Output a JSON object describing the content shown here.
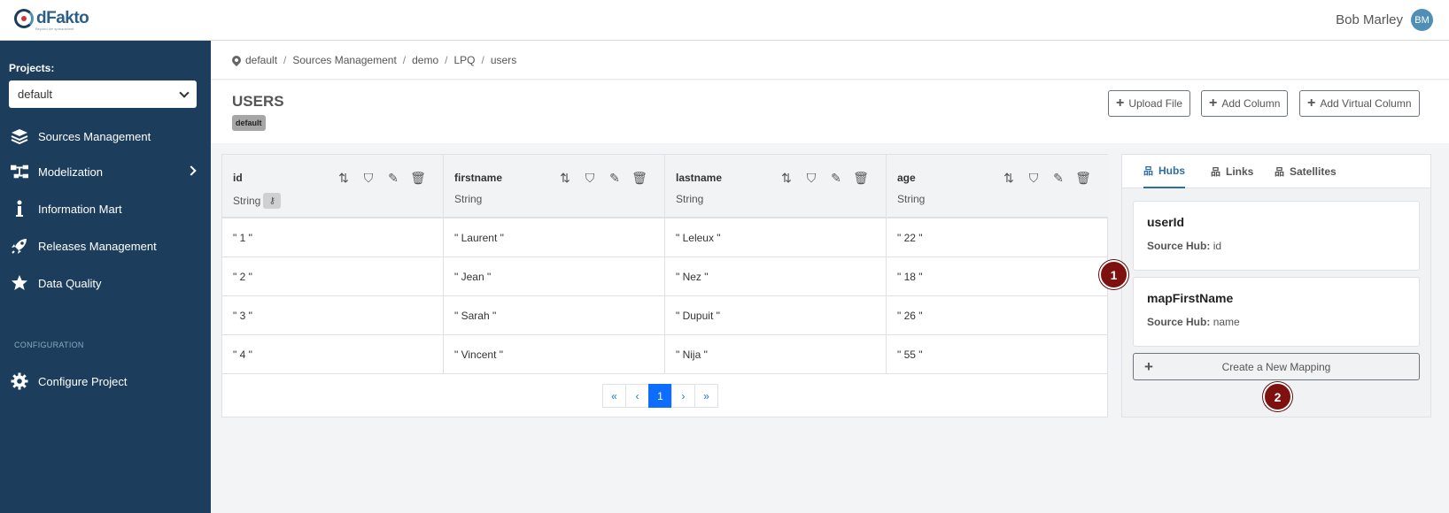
{
  "app": {
    "logo_text": "dFakto",
    "logo_tagline": "Beyond the spreadsheet"
  },
  "user": {
    "name": "Bob Marley",
    "initials": "BM"
  },
  "sidebar": {
    "projects_label": "Projects:",
    "project_selected": "default",
    "items": [
      {
        "label": "Sources Management",
        "icon": "layers-icon"
      },
      {
        "label": "Modelization",
        "icon": "sitemap-icon"
      },
      {
        "label": "Information Mart",
        "icon": "info-icon"
      },
      {
        "label": "Releases Management",
        "icon": "rocket-icon"
      },
      {
        "label": "Data Quality",
        "icon": "star-icon"
      }
    ],
    "config_label": "CONFIGURATION",
    "config_item": {
      "label": "Configure Project",
      "icon": "gear-icon"
    }
  },
  "breadcrumb": [
    "default",
    "Sources Management",
    "demo",
    "LPQ",
    "users"
  ],
  "page": {
    "title": "USERS",
    "badge": "default",
    "buttons": {
      "upload": "Upload File",
      "add_column": "Add Column",
      "add_virtual": "Add Virtual Column"
    }
  },
  "table": {
    "columns": [
      {
        "name": "id",
        "type": "String",
        "key": true
      },
      {
        "name": "firstname",
        "type": "String",
        "key": false
      },
      {
        "name": "lastname",
        "type": "String",
        "key": false
      },
      {
        "name": "age",
        "type": "String",
        "key": false
      }
    ],
    "rows": [
      [
        "\" 1 \"",
        "\" Laurent \"",
        "\" Leleux \"",
        "\" 22 \""
      ],
      [
        "\" 2 \"",
        "\" Jean \"",
        "\" Nez \"",
        "\" 18 \""
      ],
      [
        "\" 3 \"",
        "\" Sarah \"",
        "\" Dupuit \"",
        "\" 26 \""
      ],
      [
        "\" 4 \"",
        "\" Vincent \"",
        "\" Nija \"",
        "\" 55 \""
      ]
    ]
  },
  "pagination": {
    "first": "«",
    "prev": "‹",
    "current": "1",
    "next": "›",
    "last": "»"
  },
  "panel": {
    "tabs": [
      {
        "label": "Hubs",
        "active": true
      },
      {
        "label": "Links",
        "active": false
      },
      {
        "label": "Satellites",
        "active": false
      }
    ],
    "mappings": [
      {
        "title": "userId",
        "label": "Source Hub:",
        "value": "id"
      },
      {
        "title": "mapFirstName",
        "label": "Source Hub:",
        "value": "name"
      }
    ],
    "create_label": "Create a New Mapping"
  },
  "steps": [
    "1",
    "2"
  ],
  "colors": {
    "sidebar": "#1c3e5c",
    "accent": "#2d6da3",
    "step": "#7f1010"
  }
}
